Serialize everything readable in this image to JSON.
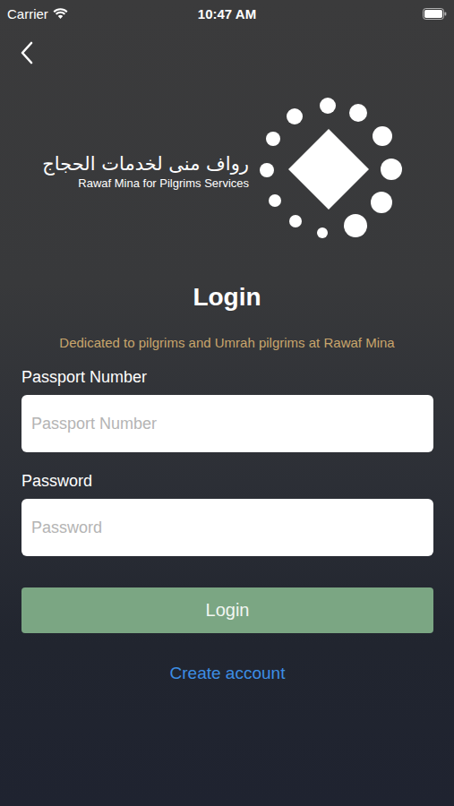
{
  "status_bar": {
    "carrier": "Carrier",
    "time": "10:47 AM"
  },
  "brand": {
    "arabic": "رواف منى لخدمات الحجاج",
    "english": "Rawaf Mina for Pilgrims Services"
  },
  "title": "Login",
  "subtitle": "Dedicated to pilgrims and Umrah pilgrims at Rawaf Mina",
  "fields": [
    {
      "label": "Passport Number",
      "placeholder": "Passport Number"
    },
    {
      "label": "Password",
      "placeholder": "Password"
    }
  ],
  "login_button": "Login",
  "create_account": "Create account"
}
